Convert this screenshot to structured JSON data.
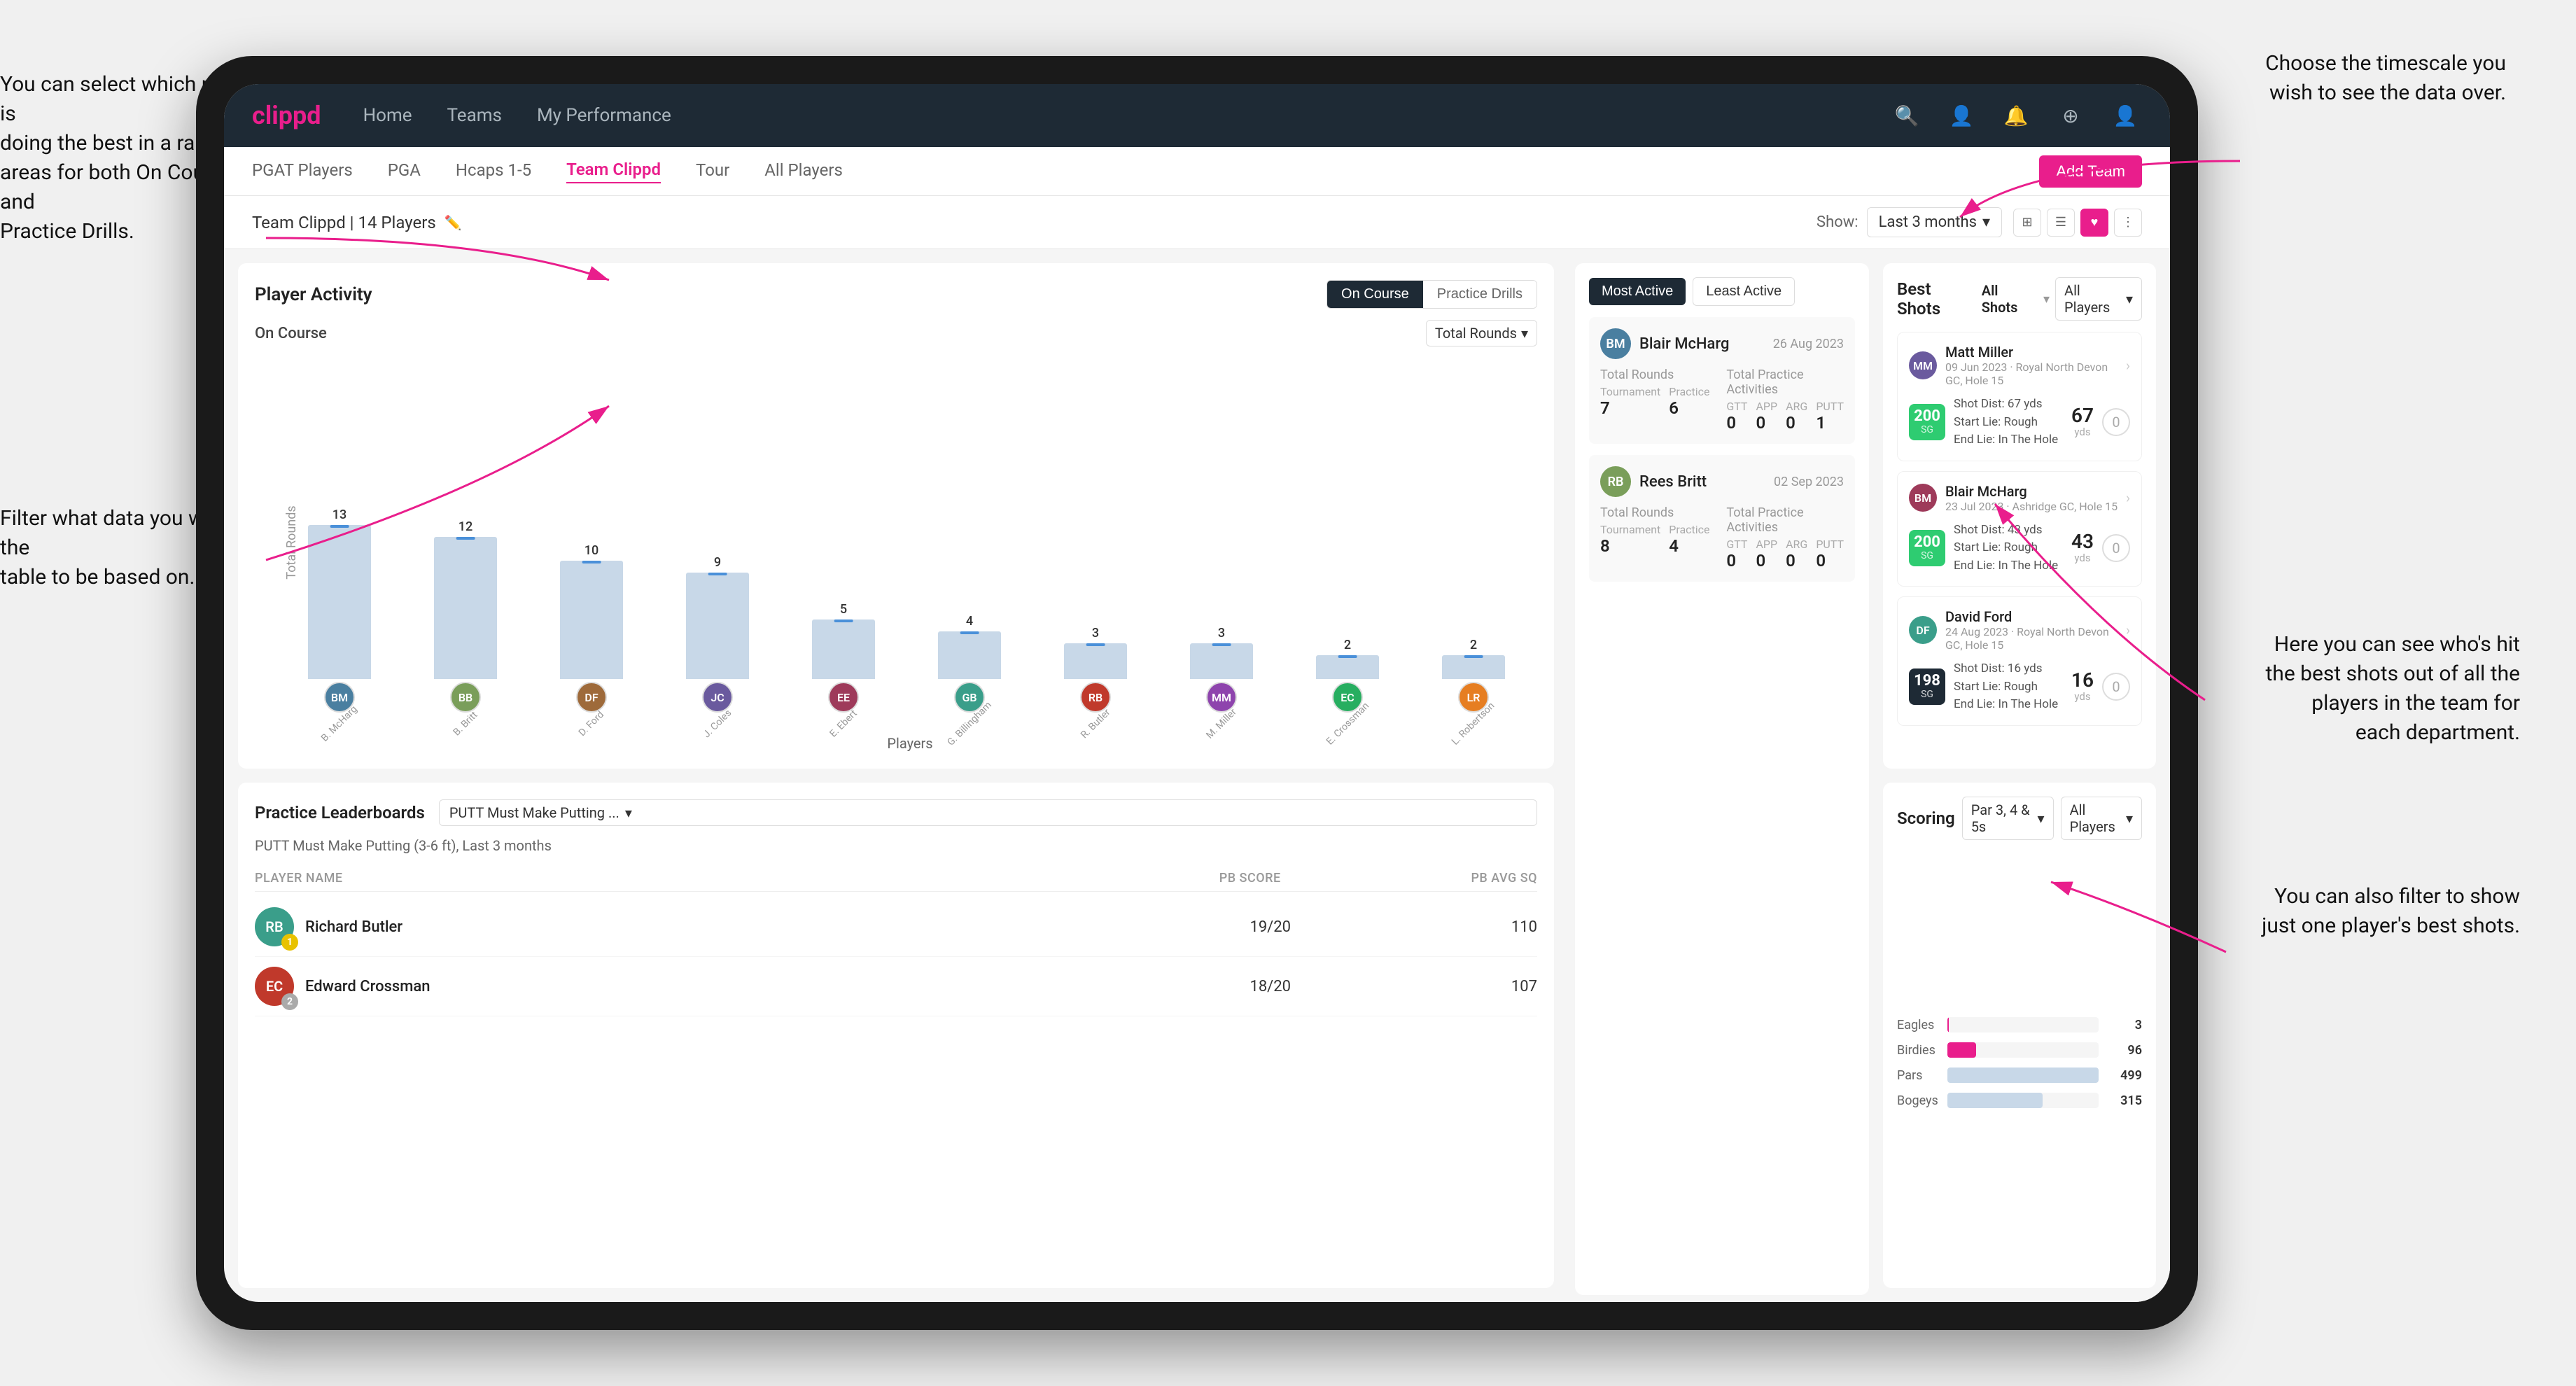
{
  "annotations": {
    "top_left": "You can select which player is\ndoing the best in a range of\nareas for both On Course and\nPractice Drills.",
    "top_right": "Choose the timescale you\nwish to see the data over.",
    "middle_left": "Filter what data you wish the\ntable to be based on.",
    "right_1": "Here you can see who's hit\nthe best shots out of all the\nplayers in the team for\neach department.",
    "right_2": "You can also filter to show\njust one player's best shots."
  },
  "nav": {
    "logo": "clippd",
    "items": [
      "Home",
      "Teams",
      "My Performance"
    ],
    "add_team": "Add Team"
  },
  "sub_nav": {
    "tabs": [
      "PGAT Players",
      "PGA",
      "Hcaps 1-5",
      "Team Clippd",
      "Tour",
      "All Players"
    ],
    "active": "Team Clippd"
  },
  "team_header": {
    "name": "Team Clippd | 14 Players",
    "show_label": "Show:",
    "time_filter": "Last 3 months",
    "view_icons": [
      "grid-4",
      "grid-list",
      "heart",
      "settings"
    ]
  },
  "activity": {
    "title": "Player Activity",
    "toggle": [
      "On Course",
      "Practice Drills"
    ],
    "active_toggle": "On Course",
    "section_label": "On Course",
    "dropdown": "Total Rounds",
    "bars": [
      {
        "name": "B. McHarg",
        "value": 13,
        "initials": "BM"
      },
      {
        "name": "B. Britt",
        "value": 12,
        "initials": "BB"
      },
      {
        "name": "D. Ford",
        "value": 10,
        "initials": "DF"
      },
      {
        "name": "J. Coles",
        "value": 9,
        "initials": "JC"
      },
      {
        "name": "E. Ebert",
        "value": 5,
        "initials": "EE"
      },
      {
        "name": "G. Billingham",
        "value": 4,
        "initials": "GB"
      },
      {
        "name": "R. Butler",
        "value": 3,
        "initials": "RB"
      },
      {
        "name": "M. Miller",
        "value": 3,
        "initials": "MM"
      },
      {
        "name": "E. Crossman",
        "value": 2,
        "initials": "EC"
      },
      {
        "name": "L. Robertson",
        "value": 2,
        "initials": "LR"
      }
    ],
    "y_label": "Total Rounds",
    "x_label": "Players"
  },
  "practice": {
    "title": "Practice Leaderboards",
    "dropdown": "PUTT Must Make Putting ...",
    "subtitle": "PUTT Must Make Putting (3-6 ft), Last 3 months",
    "headers": {
      "player_name": "PLAYER NAME",
      "pb_score": "PB SCORE",
      "pb_avg_sq": "PB AVG SQ"
    },
    "players": [
      {
        "name": "Richard Butler",
        "rank": 1,
        "pb_score": "19/20",
        "pb_avg": "110",
        "initials": "RB"
      },
      {
        "name": "Edward Crossman",
        "rank": 2,
        "pb_score": "18/20",
        "pb_avg": "107",
        "initials": "EC"
      }
    ]
  },
  "most_active": {
    "tabs": [
      "Most Active",
      "Least Active"
    ],
    "active_tab": "Most Active",
    "players": [
      {
        "name": "Blair McHarg",
        "date": "26 Aug 2023",
        "initials": "BM",
        "total_rounds_label": "Total Rounds",
        "tournament": 7,
        "practice": 6,
        "total_practice_label": "Total Practice Activities",
        "gtt": 0,
        "app": 0,
        "arg": 0,
        "putt": 1
      },
      {
        "name": "Rees Britt",
        "date": "02 Sep 2023",
        "initials": "RB",
        "total_rounds_label": "Total Rounds",
        "tournament": 8,
        "practice": 4,
        "total_practice_label": "Total Practice Activities",
        "gtt": 0,
        "app": 0,
        "arg": 0,
        "putt": 0
      }
    ]
  },
  "best_shots": {
    "title": "Best Shots",
    "tabs": [
      "All Shots",
      "Players"
    ],
    "all_players": "All Players",
    "shots": [
      {
        "player": "Matt Miller",
        "details": "09 Jun 2023 · Royal North Devon GC, Hole 15",
        "score": "200",
        "sg": "SG",
        "dist_text": "Shot Dist: 67 yds\nStart Lie: Rough\nEnd Lie: In The Hole",
        "yds": "67",
        "zero": "0",
        "color": "green",
        "initials": "MM"
      },
      {
        "player": "Blair McHarg",
        "details": "23 Jul 2023 · Ashridge GC, Hole 15",
        "score": "200",
        "sg": "SG",
        "dist_text": "Shot Dist: 43 yds\nStart Lie: Rough\nEnd Lie: In The Hole",
        "yds": "43",
        "zero": "0",
        "color": "green",
        "initials": "BM"
      },
      {
        "player": "David Ford",
        "details": "24 Aug 2023 · Royal North Devon GC, Hole 15",
        "score": "198",
        "sg": "SG",
        "dist_text": "Shot Dist: 16 yds\nStart Lie: Rough\nEnd Lie: In The Hole",
        "yds": "16",
        "zero": "0",
        "color": "dark",
        "initials": "DF"
      }
    ]
  },
  "scoring": {
    "title": "Scoring",
    "dropdown1": "Par 3, 4 & 5s",
    "dropdown2": "All Players",
    "bars": [
      {
        "label": "Eagles",
        "value": 3,
        "max": 500,
        "color": "#e91e8c"
      },
      {
        "label": "Birdies",
        "value": 96,
        "max": 500,
        "color": "#e91e8c"
      },
      {
        "label": "Pars",
        "value": 499,
        "max": 500,
        "color": "#c8d8e8"
      },
      {
        "label": "Bogeys",
        "value": 315,
        "max": 500,
        "color": "#c8d8e8"
      }
    ]
  }
}
